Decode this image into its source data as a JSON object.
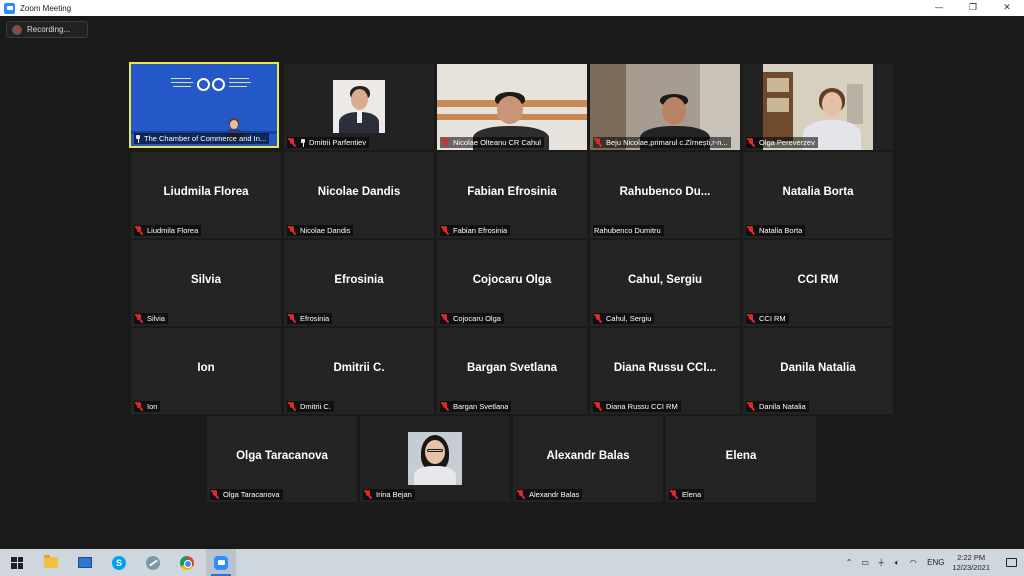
{
  "window": {
    "title": "Zoom Meeting",
    "minimize_glyph": "—",
    "maximize_glyph": "❐",
    "close_glyph": "✕"
  },
  "recording": {
    "label": "Recording..."
  },
  "participants": [
    {
      "display_name": "",
      "label": "The Chamber of Commerce and In...",
      "video": "banner",
      "mic_muted": false,
      "pinned": true,
      "active_speaker": true
    },
    {
      "display_name": "",
      "label": "Dmitrii Parfentiev",
      "video": "portrait",
      "mic_muted": true,
      "pinned": true
    },
    {
      "display_name": "",
      "label": "Nicolae Olteanu CR Cahul",
      "video": "portrait",
      "mic_muted": true
    },
    {
      "display_name": "",
      "label": "Beju Nicolae,primarul c.Zîrnești,r-n...",
      "video": "portrait",
      "mic_muted": true
    },
    {
      "display_name": "",
      "label": "Olga Pereverzev",
      "video": "portrait",
      "mic_muted": true
    },
    {
      "display_name": "Liudmila Florea",
      "label": "Liudmila Florea",
      "mic_muted": true
    },
    {
      "display_name": "Nicolae Dandis",
      "label": "Nicolae Dandis",
      "mic_muted": true
    },
    {
      "display_name": "Fabian Efrosinia",
      "label": "Fabian Efrosinia",
      "mic_muted": true
    },
    {
      "display_name": "Rahubenco Du...",
      "label": "Rahubenco Dumitru",
      "mic_muted": false
    },
    {
      "display_name": "Natalia Borta",
      "label": "Natalia Borta",
      "mic_muted": true
    },
    {
      "display_name": "Silvia",
      "label": "Silvia",
      "mic_muted": true
    },
    {
      "display_name": "Efrosinia",
      "label": "Efrosinia",
      "mic_muted": true
    },
    {
      "display_name": "Cojocaru Olga",
      "label": "Cojocaru Olga",
      "mic_muted": true
    },
    {
      "display_name": "Cahul, Sergiu",
      "label": "Cahul, Sergiu",
      "mic_muted": true
    },
    {
      "display_name": "CCI RM",
      "label": "CCI RM",
      "mic_muted": true
    },
    {
      "display_name": "Ion",
      "label": "Ion",
      "mic_muted": true
    },
    {
      "display_name": "Dmitrii C.",
      "label": "Dmitrii C.",
      "mic_muted": true
    },
    {
      "display_name": "Bargan Svetlana",
      "label": "Bargan Svetlana",
      "mic_muted": true
    },
    {
      "display_name": "Diana Russu CCI...",
      "label": "Diana Russu CCI RM",
      "mic_muted": true
    },
    {
      "display_name": "Danila Natalia",
      "label": "Danila Natalia",
      "mic_muted": true
    },
    {
      "display_name": "Olga Taracanova",
      "label": "Olga Taracanova",
      "mic_muted": true
    },
    {
      "display_name": "",
      "label": "Irina Bejan",
      "video": "portrait",
      "mic_muted": true
    },
    {
      "display_name": "Alexandr Balas",
      "label": "Alexandr Balas",
      "mic_muted": true
    },
    {
      "display_name": "Elena",
      "label": "Elena",
      "mic_muted": true
    }
  ],
  "taskbar": {
    "apps": [
      "windows-start",
      "file-explorer",
      "screen-app",
      "skype",
      "feather-app",
      "chrome",
      "zoom"
    ],
    "tray": {
      "language": "ENG",
      "time": "2:22 PM",
      "date": "12/23/2021"
    }
  },
  "colors": {
    "active_speaker_border": "#e8e84a",
    "muted_red": "#e02828",
    "zoom_blue": "#2d8cff",
    "banner_blue": "#2457c8"
  }
}
